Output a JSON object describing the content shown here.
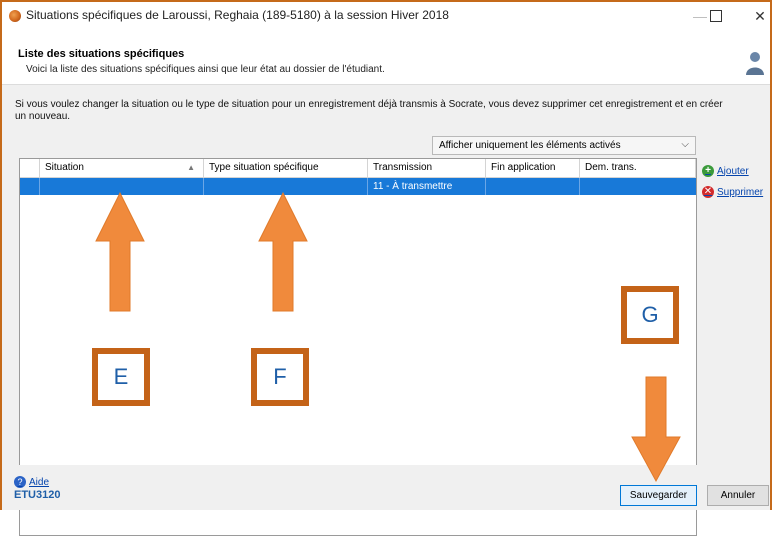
{
  "window": {
    "title": "Situations spécifiques de Laroussi, Reghaia (189-5180) à la session Hiver 2018",
    "minimize": "—",
    "close": "✕"
  },
  "header": {
    "title": "Liste des situations spécifiques",
    "subtitle": "Voici la liste des situations spécifiques ainsi que leur état au dossier de l'étudiant."
  },
  "info_text": "Si vous voulez changer la situation ou le type de situation pour un enregistrement déjà transmis à Socrate, vous devez supprimer cet enregistrement et en créer un nouveau.",
  "filter": {
    "selected": "Afficher uniquement les éléments activés",
    "chevron": "⌵"
  },
  "table": {
    "columns": [
      "Situation",
      "Type situation spécifique",
      "Transmission",
      "Fin application",
      "Dem. trans."
    ],
    "sort_icon": "▲",
    "rows": [
      {
        "situation": "",
        "type": "",
        "transmission": "11 - À transmettre",
        "fin": "",
        "dem": ""
      }
    ]
  },
  "actions": {
    "add": "Ajouter",
    "add_icon": "+",
    "delete": "Supprimer",
    "delete_icon": "✕"
  },
  "footer": {
    "help": "Aide",
    "help_icon": "?",
    "screen_code": "ETU3120",
    "save": "Sauvegarder",
    "cancel": "Annuler"
  },
  "annotations": {
    "E": "E",
    "F": "F",
    "G": "G",
    "arrow_color": "#f08a3c",
    "box_color": "#c46318"
  }
}
